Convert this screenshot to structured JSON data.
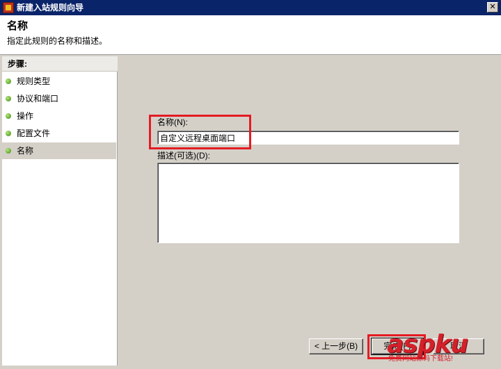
{
  "window": {
    "title": "新建入站规则向导",
    "close_glyph": "✕"
  },
  "header": {
    "title": "名称",
    "subtitle": "指定此规则的名称和描述。"
  },
  "sidebar": {
    "heading": "步骤:",
    "steps": [
      {
        "label": "规则类型",
        "active": false
      },
      {
        "label": "协议和端口",
        "active": false
      },
      {
        "label": "操作",
        "active": false
      },
      {
        "label": "配置文件",
        "active": false
      },
      {
        "label": "名称",
        "active": true
      }
    ]
  },
  "form": {
    "name_label": "名称(N):",
    "name_value": "自定义远程桌面端口",
    "description_label": "描述(可选)(D):",
    "description_value": ""
  },
  "buttons": {
    "back": "< 上一步(B)",
    "finish": "完成(F)",
    "cancel": "取消"
  },
  "watermark": {
    "brand": "aspku",
    "caption": "免费网站源码下载站!"
  },
  "colors": {
    "titlebar": "#0a246a",
    "highlight": "#e51b23",
    "step_dot": "#3a8a10",
    "watermark": "#d3202a"
  }
}
